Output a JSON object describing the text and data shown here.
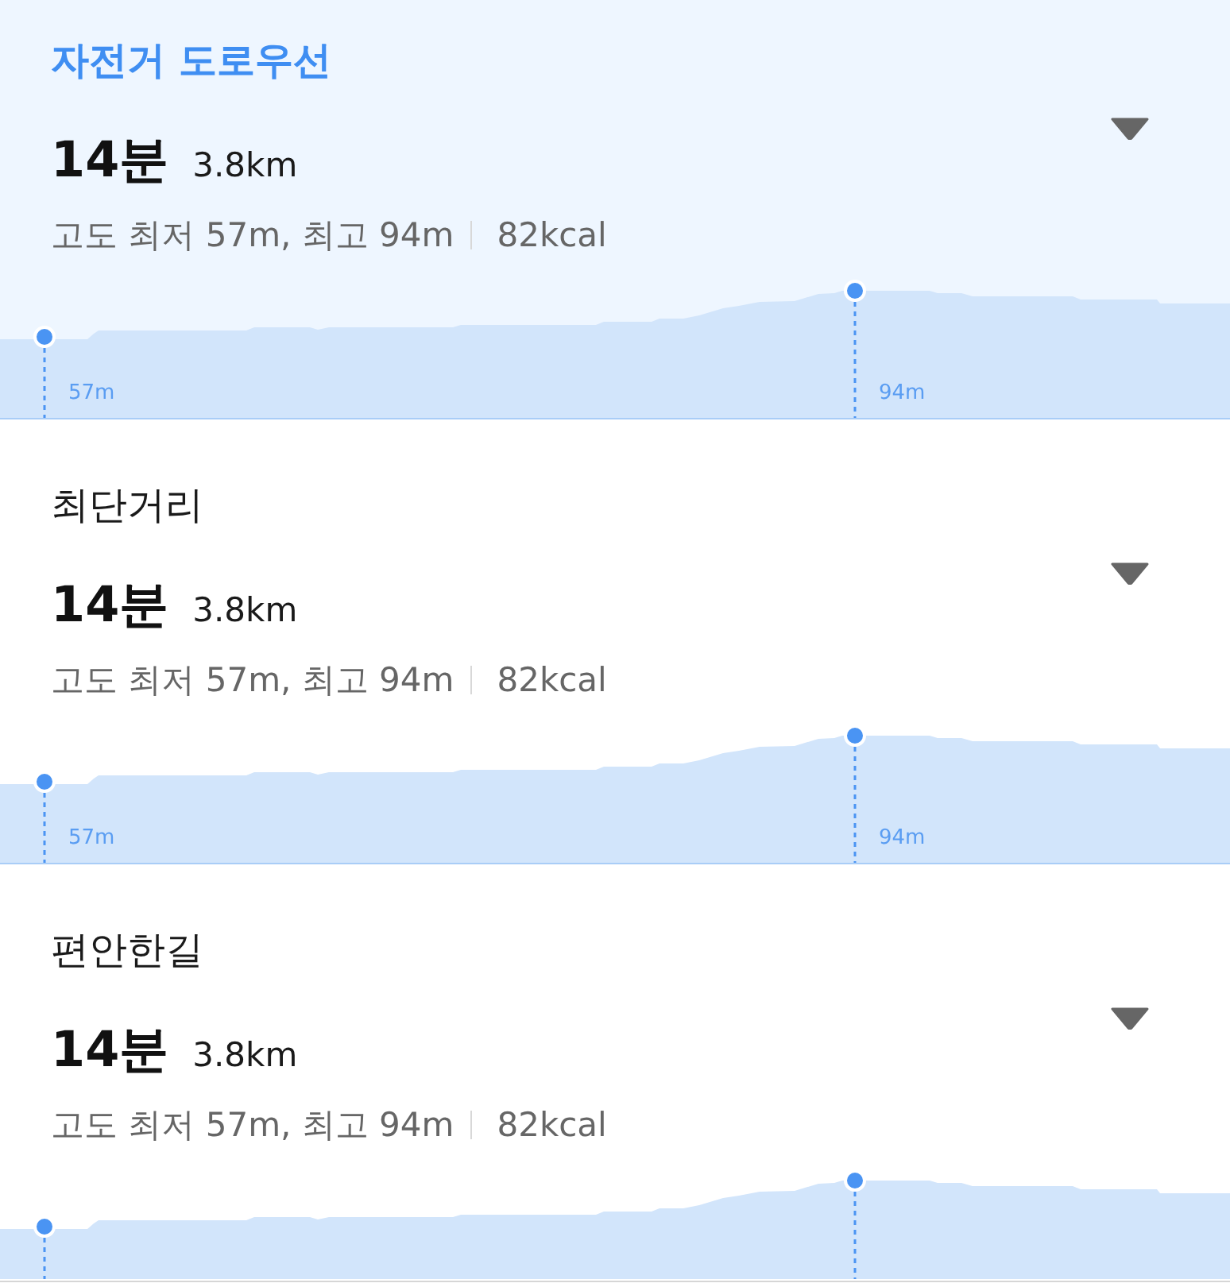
{
  "routes": [
    {
      "title": "자전거 도로우선",
      "selected": true,
      "duration": "14분",
      "distance": "3.8km",
      "elevation": "고도 최저 57m, 최고 94m",
      "calories": "82kcal",
      "min_label": "57m",
      "max_label": "94m"
    },
    {
      "title": "최단거리",
      "selected": false,
      "duration": "14분",
      "distance": "3.8km",
      "elevation": "고도 최저 57m, 최고 94m",
      "calories": "82kcal",
      "min_label": "57m",
      "max_label": "94m"
    },
    {
      "title": "편안한길",
      "selected": false,
      "duration": "14분",
      "distance": "3.8km",
      "elevation": "고도 최저 57m, 최고 94m",
      "calories": "82kcal"
    }
  ]
}
